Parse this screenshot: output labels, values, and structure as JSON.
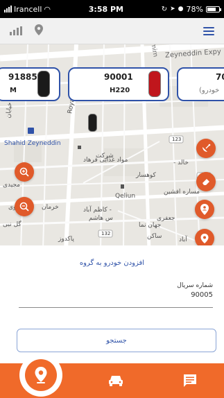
{
  "status_bar": {
    "carrier": "Irancell",
    "time": "3:58 PM",
    "battery": "78%"
  },
  "top_bar": {
    "signal_icon": "signal-bars-icon",
    "location_icon": "location-pin-icon",
    "menu_icon": "hamburger-menu-icon",
    "accent_color": "#2f52a8"
  },
  "map": {
    "labels": [
      "Amirn",
      "Zeyneddin Expy",
      "Shahid Zeyneddin",
      "Roya",
      "کاظم آباد",
      "شرکت",
      "مواد غذایی فرهاد",
      "کوهسار",
      "Qeliun",
      "کاظم آباد -",
      "س هاشم",
      "123",
      "132",
      "123",
      "خرمان",
      "جعفری",
      "جهان نما",
      "ساکن",
      "پاکدوز",
      "مجیدی",
      "مساره افشین",
      "کوی",
      "گل نبی",
      "خیابان",
      "- خالد",
      "آباد"
    ]
  },
  "vehicles": [
    {
      "plate": "918850",
      "model": "M",
      "car_color": "black"
    },
    {
      "plate": "90001",
      "model": "H220",
      "car_color": "red"
    },
    {
      "plate": "70",
      "model": "(خودرو",
      "car_color": "black"
    }
  ],
  "fabs": {
    "zoom_in_icon": "zoom-in-icon",
    "zoom_out_icon": "zoom-out-icon",
    "satellite_icon": "satellite-dish-icon",
    "eraser_icon": "eraser-icon",
    "person_location_icon": "person-pin-icon",
    "location_icon": "location-pin-icon",
    "color": "#e05a2a"
  },
  "sheet": {
    "title": "افزودن خودرو به گروه",
    "serial_label": "شماره سریال",
    "serial_value": "90005",
    "search_button": "جستجو"
  },
  "bottom_nav": {
    "items": [
      {
        "icon": "location-pin-icon",
        "active": true
      },
      {
        "icon": "car-icon",
        "active": false
      },
      {
        "icon": "message-icon",
        "active": false
      }
    ],
    "color": "#f06a2a"
  }
}
